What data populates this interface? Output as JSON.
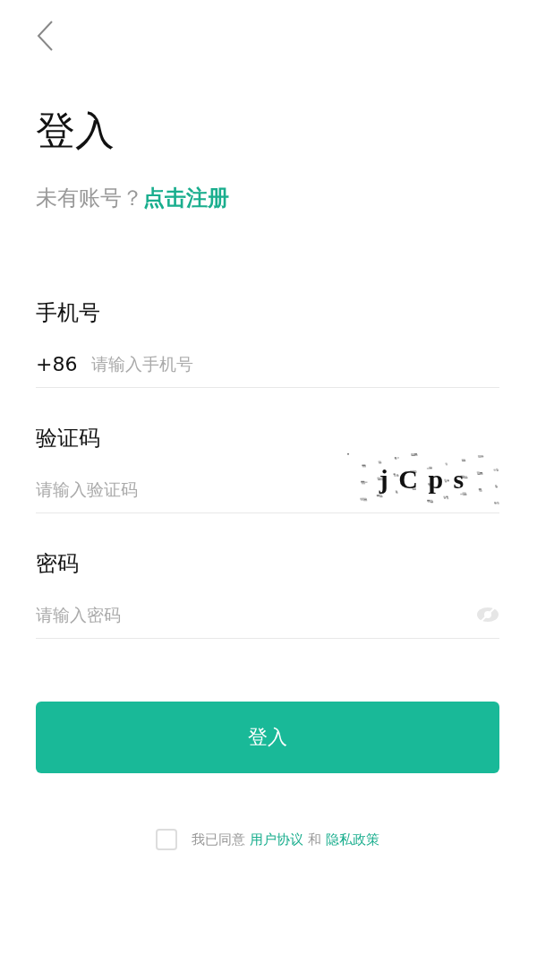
{
  "title": "登入",
  "signup": {
    "prompt": "未有账号？",
    "link": "点击注册"
  },
  "fields": [
    {
      "kind": "phone",
      "label": "手机号",
      "prefix": "+86",
      "placeholder": "请输入手机号"
    },
    {
      "kind": "captcha",
      "label": "验证码",
      "placeholder": "请输入验证码",
      "captcha": "j C p s"
    },
    {
      "kind": "password",
      "label": "密码",
      "placeholder": "请输入密码",
      "visible": false
    }
  ],
  "login_button": "登入",
  "agreement": {
    "checked": false,
    "text": "我已同意",
    "terms": "用户协议",
    "and": "和",
    "privacy": "隐私政策"
  }
}
